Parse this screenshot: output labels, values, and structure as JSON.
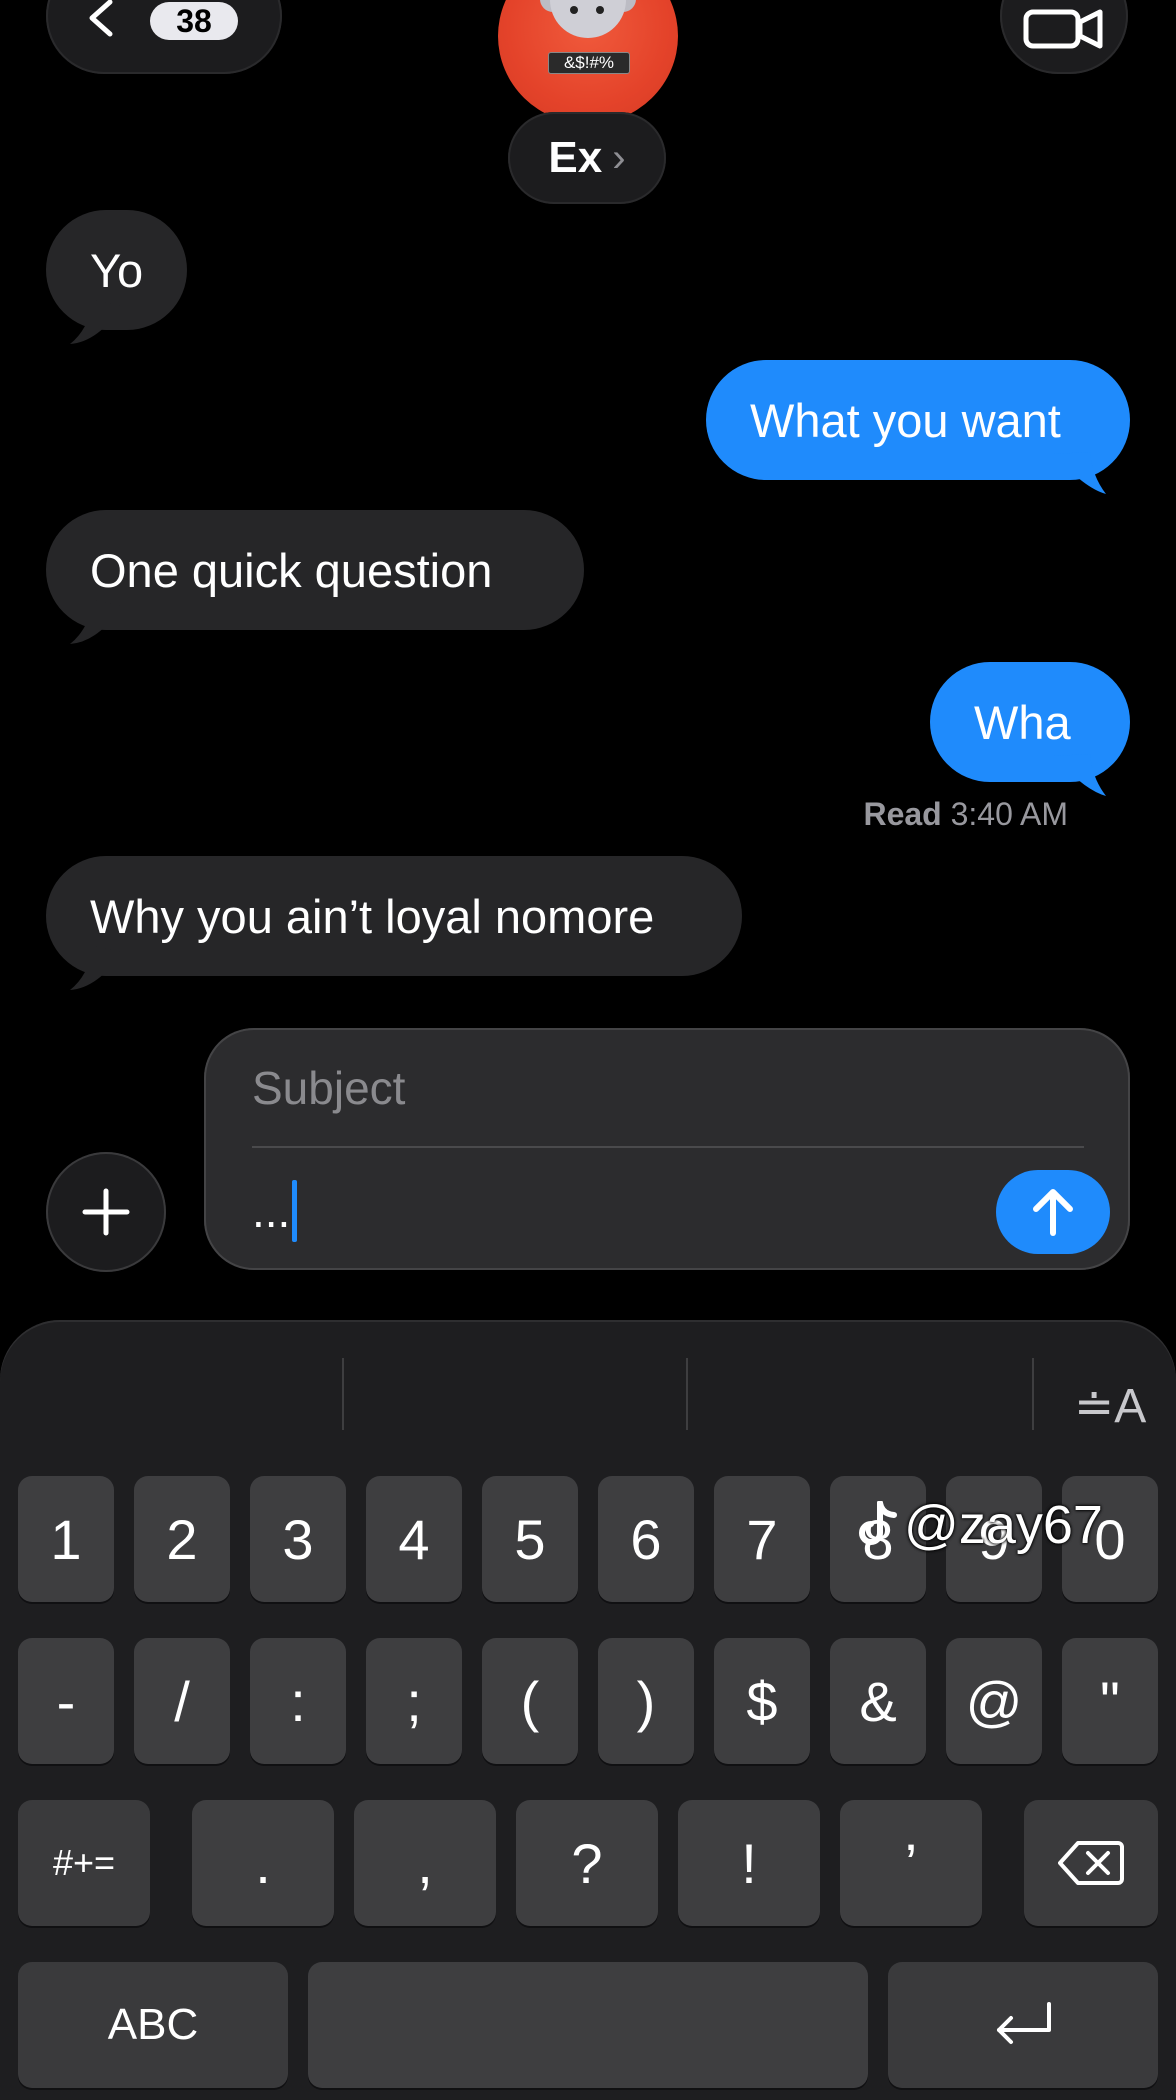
{
  "header": {
    "back_count": "38",
    "contact_name": "Ex",
    "name_chevron": "›",
    "avatar_censor_text": "&$!#%"
  },
  "messages": [
    {
      "side": "in",
      "text": "Yo"
    },
    {
      "side": "out",
      "text": "What you want"
    },
    {
      "side": "in",
      "text": "One quick question"
    },
    {
      "side": "out",
      "text": "Wha"
    },
    {
      "side": "in",
      "text": "Why you ain’t loyal nomore"
    }
  ],
  "read_receipt": {
    "label": "Read",
    "time": "3:40 AM"
  },
  "compose": {
    "subject_placeholder": "Subject",
    "body_text": "..."
  },
  "keyboard": {
    "format_label": "≐A",
    "row1": [
      "1",
      "2",
      "3",
      "4",
      "5",
      "6",
      "7",
      "8",
      "9",
      "0"
    ],
    "row2": [
      "-",
      "/",
      ":",
      ";",
      "(",
      ")",
      "$",
      "&",
      "@",
      "\""
    ],
    "row3_mod": "#+=",
    "row3": [
      ".",
      ",",
      "?",
      "!",
      "’"
    ],
    "abc_label": "ABC"
  },
  "watermark": {
    "handle": "@zay67"
  },
  "colors": {
    "accent": "#1f8bfc",
    "incoming": "#262628",
    "background": "#000000"
  }
}
